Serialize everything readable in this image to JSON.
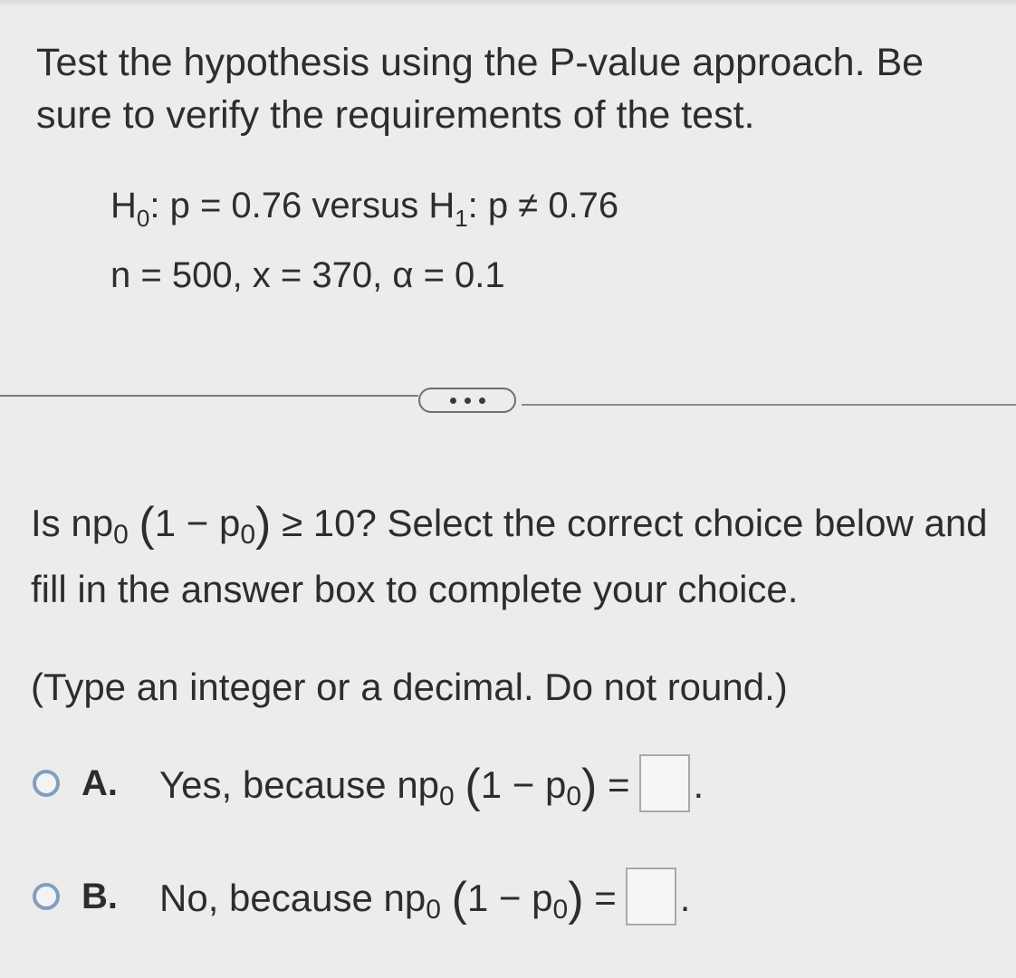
{
  "prompt": {
    "text": "Test the hypothesis using the P-value approach. Be sure to verify the requirements of the test."
  },
  "hypotheses": {
    "h0_label": "H",
    "h0_sub": "0",
    "h0_rest": ": p = 0.76 versus ",
    "h1_label": "H",
    "h1_sub": "1",
    "h1_rest": ": p ≠ 0.76",
    "params": "n = 500, x = 370, α = 0.1"
  },
  "question": {
    "lead": "Is np",
    "sub": "0",
    "open": "(",
    "mid": "1 − p",
    "sub2": "0",
    "close": ")",
    "rest": " ≥ 10? Select the correct choice below and fill in the answer box to complete your choice.",
    "instruction": "(Type an integer or a decimal. Do not round.)"
  },
  "choices": [
    {
      "letter": "A.",
      "prefix": "Yes, because np",
      "sub": "0",
      "open": "(",
      "mid": "1 − p",
      "sub2": "0",
      "close": ")",
      "equals": "=",
      "answer_value": "",
      "period": "."
    },
    {
      "letter": "B.",
      "prefix": "No, because np",
      "sub": "0",
      "open": "(",
      "mid": "1 − p",
      "sub2": "0",
      "close": ")",
      "equals": "=",
      "answer_value": "",
      "period": "."
    }
  ],
  "colors": {
    "background": "#ececec",
    "text": "#2d2d2d",
    "radio_border": "#7f9fbf",
    "divider": "#7c7c7c"
  }
}
